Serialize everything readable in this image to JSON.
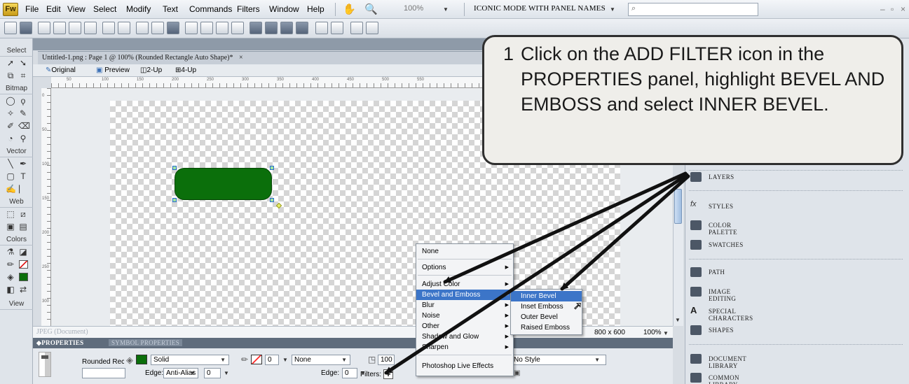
{
  "menubar": {
    "logo": "Fw",
    "items": [
      "File",
      "Edit",
      "View",
      "Select",
      "Modify",
      "Text",
      "Commands",
      "Filters",
      "Window",
      "Help"
    ],
    "zoom": "100%",
    "workspace_mode": "ICONIC MODE WITH PANEL NAMES"
  },
  "document": {
    "tab_title": "Untitled-1.png : Page 1 @ 100% (Rounded Rectangle Auto Shape)*",
    "tab_close": "×",
    "views": [
      "Original",
      "Preview",
      "2-Up",
      "4-Up"
    ],
    "canvas_size": "800 x 600",
    "zoom": "100%",
    "status_ghost": "JPEG (Document)",
    "ruler_marks": [
      "50",
      "100",
      "150",
      "200",
      "250",
      "300",
      "350",
      "400",
      "450",
      "500",
      "550"
    ],
    "ruler_left_marks": [
      "0",
      "50",
      "100",
      "150",
      "200",
      "250",
      "300"
    ]
  },
  "tools": {
    "sections": [
      "Select",
      "Bitmap",
      "Vector",
      "Web",
      "Colors",
      "View"
    ]
  },
  "properties": {
    "tabs": [
      "PROPERTIES",
      "SYMBOL PROPERTIES"
    ],
    "object_name": "Rounded Recta",
    "fill_type": "Solid",
    "edge_label": "Edge:",
    "edge_value": "Anti-Alias",
    "edge_amount": "0",
    "stroke_value": "0",
    "stroke_type": "None",
    "stroke_edge_label": "Edge:",
    "stroke_edge_value": "0",
    "opacity": "100",
    "filters_label": "Filters:",
    "add_filter": "+",
    "style": "No Style"
  },
  "right_panel": {
    "items": [
      "LAYERS",
      "STYLES",
      "COLOR PALETTE",
      "SWATCHES",
      "PATH",
      "IMAGE EDITING",
      "SPECIAL CHARACTERS",
      "SHAPES",
      "DOCUMENT LIBRARY",
      "COMMON LIBRARY"
    ]
  },
  "filter_menu": {
    "items": [
      "None",
      "Options",
      "Adjust Color",
      "Bevel and Emboss",
      "Blur",
      "Noise",
      "Other",
      "Shadow and Glow",
      "Sharpen",
      "Photoshop Live Effects"
    ],
    "highlighted": "Bevel and Emboss"
  },
  "bevel_submenu": {
    "items": [
      "Inner Bevel",
      "Inset Emboss",
      "Outer Bevel",
      "Raised Emboss"
    ],
    "highlighted": "Inner Bevel"
  },
  "callout": {
    "number": "1",
    "text": "Click on the ADD FILTER icon in the PROPERTIES panel, highlight BEVEL AND EMBOSS and select INNER BEVEL."
  },
  "colors": {
    "fill": "#0b6f0b",
    "menu_highlight": "#3c75c8",
    "stroke_none": "#ff2a2a"
  }
}
